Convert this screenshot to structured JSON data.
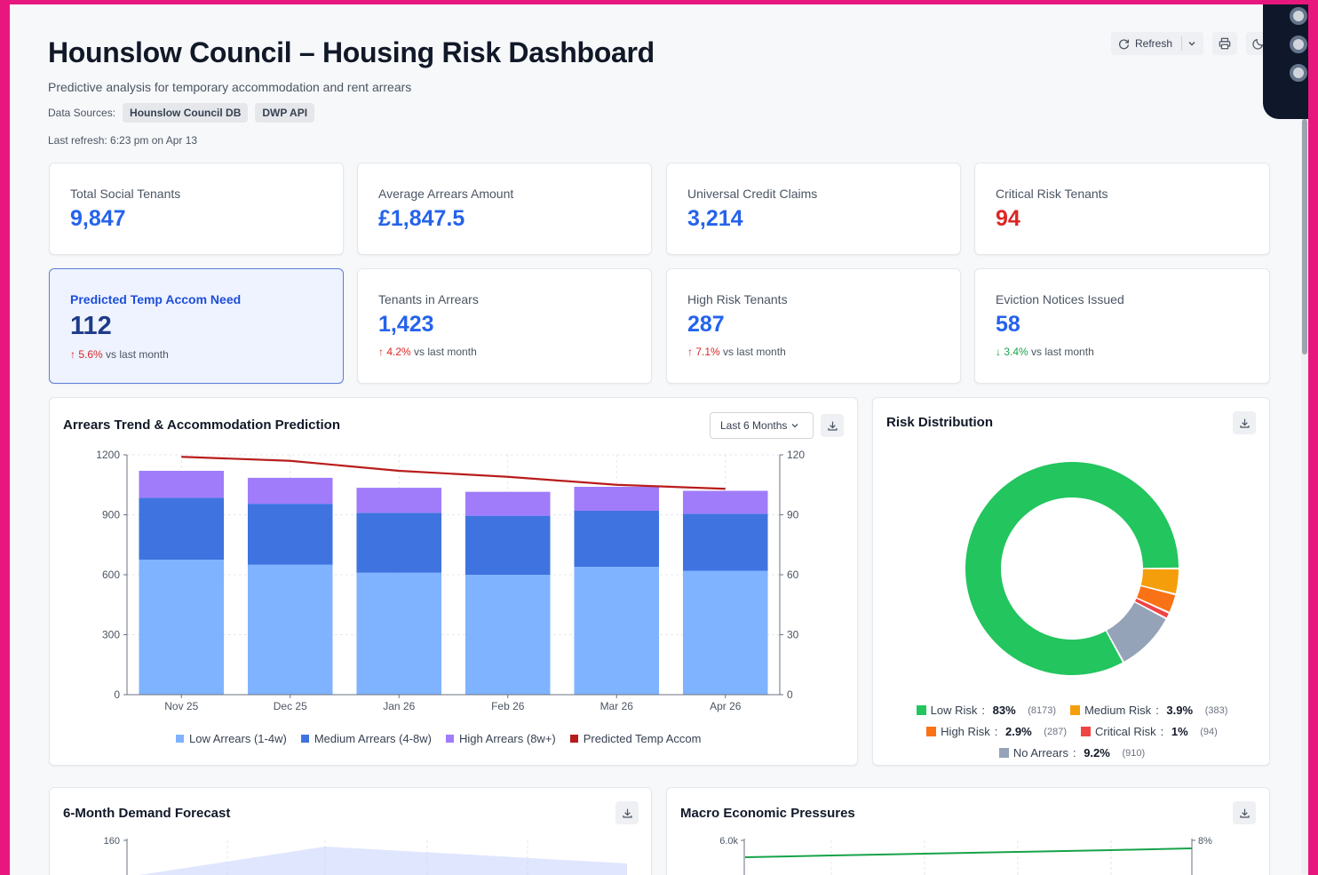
{
  "header": {
    "title": "Hounslow Council – Housing Risk Dashboard",
    "subtitle": "Predictive analysis for temporary accommodation and rent arrears",
    "data_sources_label": "Data Sources:",
    "data_sources": [
      "Hounslow Council DB",
      "DWP API"
    ],
    "last_refresh": "Last refresh: 6:23 pm on Apr 13"
  },
  "toolbar": {
    "refresh_label": "Refresh"
  },
  "kpis_row1": [
    {
      "label": "Total Social Tenants",
      "value": "9,847"
    },
    {
      "label": "Average Arrears Amount",
      "value": "£1,847.5"
    },
    {
      "label": "Universal Credit Claims",
      "value": "3,214"
    },
    {
      "label": "Critical Risk Tenants",
      "value": "94",
      "color": "#dc2626"
    }
  ],
  "kpis_row2": [
    {
      "label": "Predicted Temp Accom Need",
      "value": "112",
      "change": "5.6%",
      "dir": "up",
      "suffix": "vs last month"
    },
    {
      "label": "Tenants in Arrears",
      "value": "1,423",
      "change": "4.2%",
      "dir": "up",
      "suffix": "vs last month"
    },
    {
      "label": "High Risk Tenants",
      "value": "287",
      "change": "7.1%",
      "dir": "up",
      "suffix": "vs last month"
    },
    {
      "label": "Eviction Notices Issued",
      "value": "58",
      "change": "3.4%",
      "dir": "down",
      "suffix": "vs last month"
    }
  ],
  "trend_card": {
    "title": "Arrears Trend & Accommodation Prediction",
    "range_label": "Last 6 Months"
  },
  "risk_card": {
    "title": "Risk Distribution"
  },
  "forecast_card": {
    "title": "6-Month Demand Forecast"
  },
  "macro_card": {
    "title": "Macro Economic Pressures"
  },
  "colors": {
    "low_arrears": "#7fb3ff",
    "medium_arrears": "#3f73e0",
    "high_arrears": "#a07cfb",
    "temp_accom": "#b91c1c",
    "low_risk": "#22c55e",
    "medium_risk": "#f59e0b",
    "high_risk": "#f97316",
    "critical_risk": "#ef4444",
    "no_arrears": "#94a3b8"
  },
  "chart_data": [
    {
      "type": "bar",
      "stacked": true,
      "title": "Arrears Trend & Accommodation Prediction",
      "categories": [
        "Nov 25",
        "Dec 25",
        "Jan 26",
        "Feb 26",
        "Mar 26",
        "Apr 26"
      ],
      "ylim": [
        0,
        1200
      ],
      "y_ticks": [
        "1200",
        "900",
        "600",
        "300",
        "0"
      ],
      "y2lim": [
        0,
        120
      ],
      "y2_ticks": [
        "120",
        "90",
        "60",
        "30",
        "0"
      ],
      "series": [
        {
          "name": "Low Arrears (1-4w)",
          "values": [
            675,
            650,
            610,
            600,
            640,
            620
          ]
        },
        {
          "name": "Medium Arrears (4-8w)",
          "values": [
            310,
            305,
            300,
            295,
            280,
            285
          ]
        },
        {
          "name": "High Arrears (8w+)",
          "values": [
            135,
            130,
            125,
            120,
            120,
            115
          ]
        },
        {
          "name": "Predicted Temp Accom",
          "type": "line",
          "axis": "right",
          "values": [
            119,
            117,
            112,
            109,
            105,
            103
          ]
        }
      ],
      "legend_position": "bottom",
      "grid": true
    },
    {
      "type": "pie",
      "donut": true,
      "title": "Risk Distribution",
      "labels": [
        "Low Risk",
        "Medium Risk",
        "High Risk",
        "Critical Risk",
        "No Arrears"
      ],
      "values": [
        8173,
        383,
        287,
        94,
        910
      ],
      "percent_labels": [
        "83%",
        "3.9%",
        "2.9%",
        "1%",
        "9.2%"
      ],
      "count_labels": [
        "(8173)",
        "(383)",
        "(287)",
        "(94)",
        "(910)"
      ],
      "legend_position": "bottom"
    },
    {
      "type": "area",
      "title": "6-Month Demand Forecast",
      "y_ticks": [
        "160"
      ],
      "grid": true
    },
    {
      "type": "line",
      "title": "Macro Economic Pressures",
      "y_ticks": [
        "6.0k"
      ],
      "y2_ticks": [
        "8%"
      ],
      "grid": true
    }
  ]
}
